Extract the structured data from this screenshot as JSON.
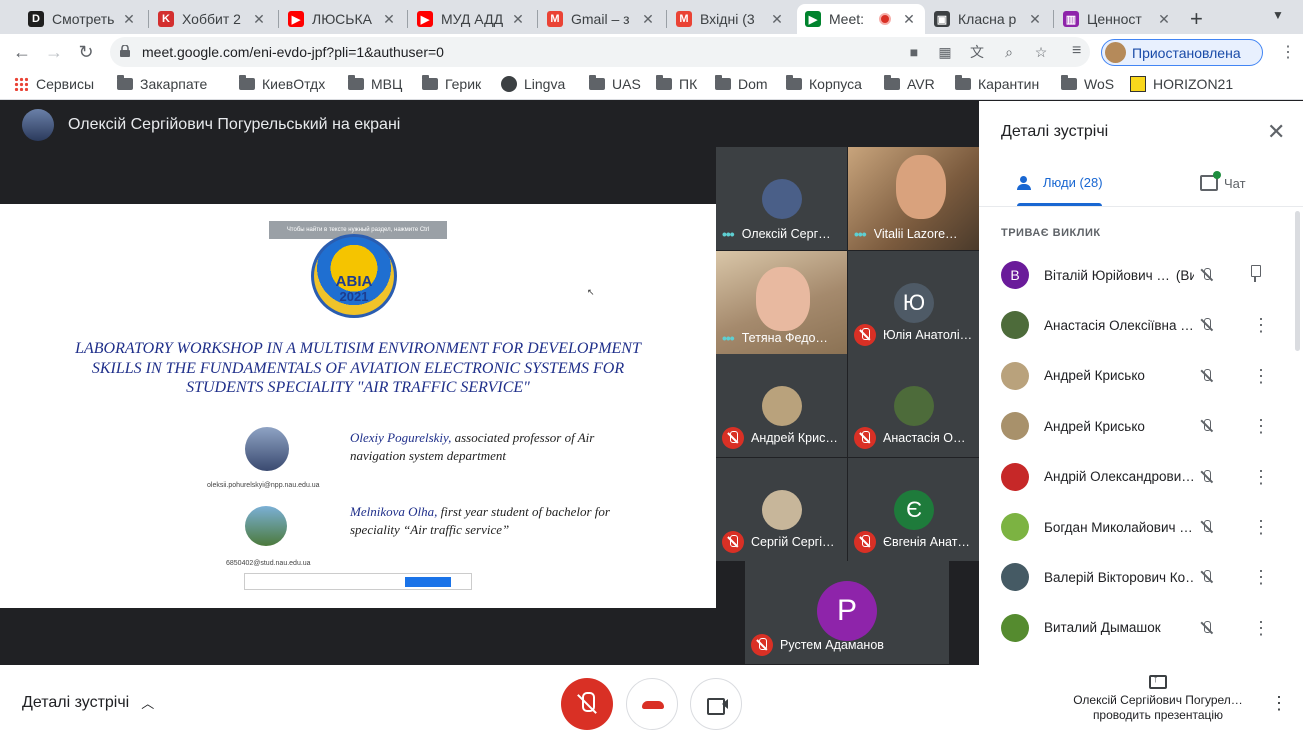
{
  "tabs": [
    {
      "title": "Смотреть",
      "favicon": "D",
      "color": "#1f1f1f"
    },
    {
      "title": "Хоббит 2",
      "favicon": "K",
      "color": "#d32f2f"
    },
    {
      "title": "ЛЮСЬКА",
      "favicon": "▶",
      "color": "#ff0000"
    },
    {
      "title": "МУД АДД",
      "favicon": "▶",
      "color": "#ff0000"
    },
    {
      "title": "Gmail – з",
      "favicon": "M",
      "color": "#ea4335"
    },
    {
      "title": "Вхідні (3",
      "favicon": "M",
      "color": "#ea4335"
    },
    {
      "title": "Meet:",
      "favicon": "▶",
      "color": "#00832d"
    },
    {
      "title": "Класна р",
      "favicon": "▣",
      "color": "#3c4043"
    },
    {
      "title": "Ценност",
      "favicon": "▥",
      "color": "#8e24aa"
    }
  ],
  "address_bar": {
    "url": "meet.google.com/eni-evdo-jpf?pli=1&authuser=0"
  },
  "profile": {
    "label": "Приостановлена"
  },
  "bookmarks": [
    "Сервисы",
    "Закарпате",
    "КиевОтдх",
    "МВЦ",
    "Герик",
    "Lingva",
    "UAS",
    "ПК",
    "Dom",
    "Корпуса",
    "AVR",
    "Карантин",
    "WoS",
    "HORIZON21"
  ],
  "presenter": {
    "title": "Олексій Сергійович Погурельський на екрані"
  },
  "slide": {
    "banner": "Чтобы найти в тексте нужный раздел, нажмите Ctrl",
    "logo_abbr": "АВІА",
    "logo_year": "2021",
    "title": "LABORATORY WORKSHOP IN A MULTISIM ENVIRONMENT FOR DEVELOPMENT SKILLS IN THE FUNDAMENTALS OF AVIATION ELECTRONIC SYSTEMS FOR STUDENTS SPECIALITY \"AIR TRAFFIC SERVICE\"",
    "author1_name": "Olexiy Pogurelskiy,",
    "author1_desc": " associated professor of Air navigation system department",
    "author1_email": "oleksii.pohurelskyi@npp.nau.edu.ua",
    "author2_name": "Melnikova Olha,",
    "author2_desc": "  first year student of  bachelor for speciality “Air traffic service”",
    "author2_email": "6850402@stud.nau.edu.ua"
  },
  "tiles": [
    {
      "name": "Олексій Серг…",
      "state": "speaking",
      "avatar_color": "#4a5f88"
    },
    {
      "name": "Vitalii Lazore…",
      "state": "speaking",
      "avatar_color": "#8b6a4a"
    },
    {
      "name": "Тетяна Федо…",
      "state": "speaking",
      "avatar_color": "#b49478"
    },
    {
      "name": "Юлія Анатолі…",
      "state": "muted",
      "letter": "Ю",
      "avatar_color": "#4e5a66"
    },
    {
      "name": "Андрей Крис…",
      "state": "muted",
      "avatar_color": "#b9a27c"
    },
    {
      "name": "Анастасія О…",
      "state": "muted",
      "avatar_color": "#4d6b3a"
    },
    {
      "name": "Сергій Сергі…",
      "state": "muted",
      "avatar_color": "#c7b69a"
    },
    {
      "name": "Євгенія Анат…",
      "state": "muted",
      "letter": "Є",
      "avatar_color": "#1e7b3b"
    },
    {
      "name": "Рустем Адаманов",
      "state": "muted",
      "letter": "Р",
      "avatar_color": "#8e24aa"
    }
  ],
  "sidebar": {
    "title": "Деталі зустрічі",
    "tab_people": "Люди (28)",
    "tab_chat": "Чат",
    "section": "ТРИВАЄ ВИКЛИК",
    "people": [
      {
        "name": "Віталій Юрійович …",
        "suffix": "(Ви)",
        "letter": "В",
        "color": "#6a1b9a"
      },
      {
        "name": "Анастасія Олексіївна …",
        "color": "#4d6b3a"
      },
      {
        "name": "Андрей Крисько",
        "color": "#b9a27c"
      },
      {
        "name": "Андрей Крисько",
        "color": "#a8916b"
      },
      {
        "name": "Андрій Олександрови…",
        "color": "#c62828"
      },
      {
        "name": "Богдан Миколайович …",
        "color": "#7cb342"
      },
      {
        "name": "Валерій Вікторович Ко…",
        "color": "#455a64"
      },
      {
        "name": "Виталий Дымашок",
        "color": "#558b2f"
      }
    ]
  },
  "bottom": {
    "details": "Деталі зустрічі",
    "presenting_line1": "Олексій Сергійович Погурел…",
    "presenting_line2": "проводить презентацію"
  }
}
